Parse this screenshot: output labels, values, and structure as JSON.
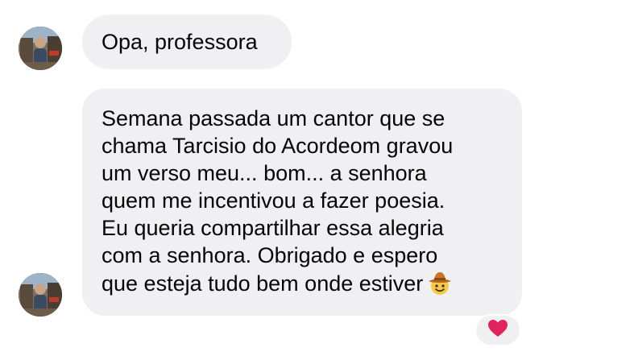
{
  "messages": [
    {
      "text": "Opa, professora"
    },
    {
      "lines": [
        "Semana passada um cantor que se",
        "chama Tarcisio do Acordeom gravou",
        "um verso meu... bom... a senhora",
        "quem me incentivou a fazer poesia.",
        "Eu queria compartilhar essa alegria",
        "com a senhora. Obrigado e espero",
        "que esteja tudo bem onde estiver"
      ],
      "trailing_emoji": "cowboy-hat-face-icon"
    }
  ],
  "reaction": {
    "icon": "red-heart-icon",
    "color": "#e0245e"
  },
  "colors": {
    "bubble_background": "#f0f0f3",
    "text": "#050505"
  }
}
